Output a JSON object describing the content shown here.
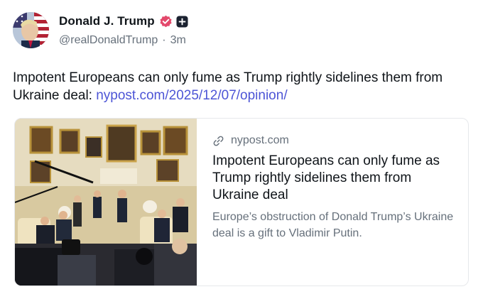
{
  "post": {
    "author": {
      "display_name": "Donald J. Trump",
      "handle": "@realDonaldTrump",
      "separator": "·",
      "time_ago": "3m",
      "verified_icon": "verified-badge-icon",
      "plus_icon": "plus-badge-icon"
    },
    "text": "Impotent Europeans can only fume as Trump rightly sidelines them from Ukraine deal: ",
    "link_text": "nypost.com/2025/12/07/opinion/",
    "link_card": {
      "domain": "nypost.com",
      "domain_icon": "link-icon",
      "title": "Impotent Europeans can only fume as Trump rightly sidelines them from Ukraine deal",
      "description": "Europe’s obstruction of Donald Trump’s Ukraine deal is a gift to Vladimir Putin.",
      "image": "oval-office-meeting-photo"
    }
  },
  "colors": {
    "link": "#4d55d6",
    "secondary_text": "#66707b",
    "verified_badge": "#e3486b",
    "card_border": "#e6e8eb"
  }
}
